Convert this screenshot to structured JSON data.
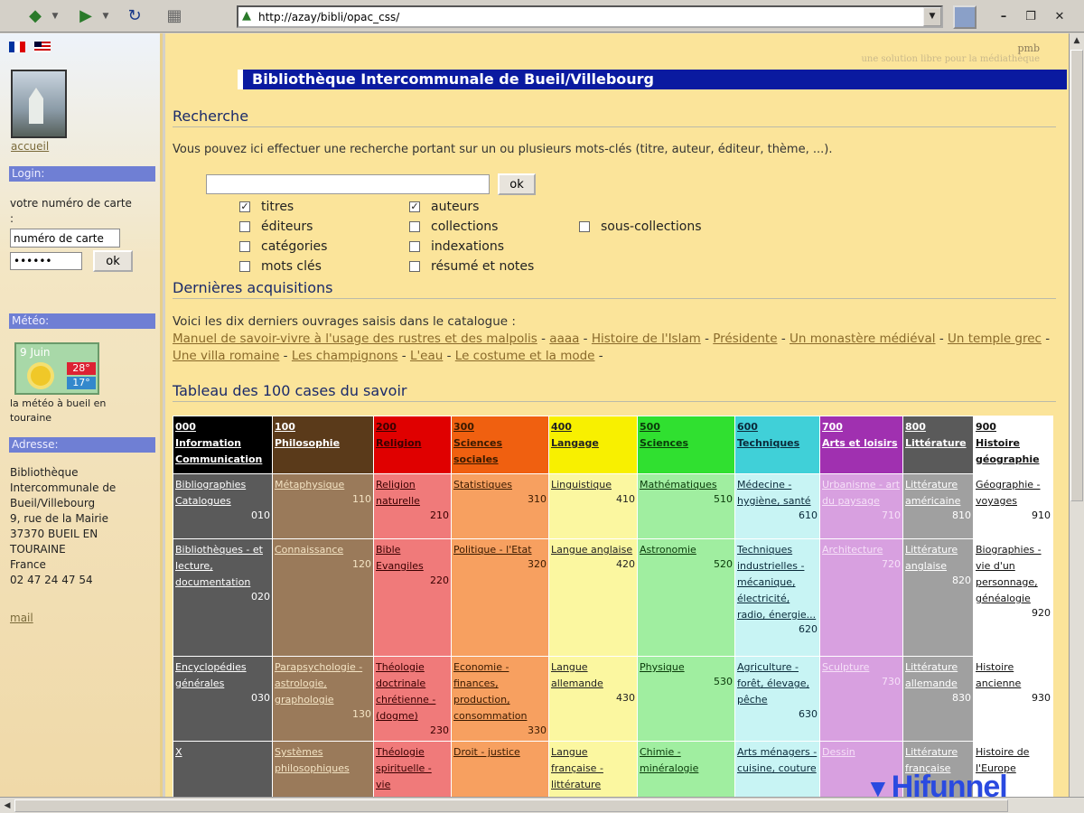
{
  "browser": {
    "url": "http://azay/bibli/opac_css/"
  },
  "sidebar": {
    "accueil": "accueil",
    "login_header": "Login:",
    "card_label": "votre numéro de carte",
    "card_colon": ":",
    "card_input": "numéro de carte",
    "password_input": "••••••",
    "ok": "ok",
    "meteo_header": "Météo:",
    "meteo_date": "9 Juin",
    "meteo_max": "28°",
    "meteo_min": "17°",
    "meteo_caption_1": "la météo à bueil en",
    "meteo_caption_2": "touraine",
    "address_header": "Adresse:",
    "address": [
      "Bibliothèque",
      "Intercommunale de",
      "Bueil/Villebourg",
      "9, rue de la Mairie",
      "37370 BUEIL EN",
      "TOURAINE",
      "France",
      "02 47 24 47 54"
    ],
    "mail": "mail"
  },
  "main": {
    "pmb": "pmb",
    "pmb_tagline": "une solution libre pour la médiathèque",
    "banner": "Bibliothèque Intercommunale de Bueil/Villebourg",
    "search_title": "Recherche",
    "search_intro": "Vous pouvez ici effectuer une recherche portant sur un ou plusieurs mots-clés (titre, auteur, éditeur, thème, ...).",
    "search_ok": "ok",
    "checks": {
      "titres": "titres",
      "auteurs": "auteurs",
      "editeurs": "éditeurs",
      "collections": "collections",
      "sous_collections": "sous-collections",
      "categories": "catégories",
      "indexations": "indexations",
      "mots_cles": "mots clés",
      "resume": "résumé et notes"
    },
    "check_mark": "✓",
    "acq_title": "Dernières acquisitions",
    "acq_intro": "Voici les dix derniers ouvrages saisis dans le catalogue :",
    "acq_sep": " - ",
    "acquisitions": [
      "Manuel de savoir-vivre à l'usage des rustres et des malpolis",
      "aaaa",
      "Histoire de l'Islam",
      "Présidente",
      "Un monastère médiéval",
      "Un temple grec",
      "Une villa romaine",
      "Les champignons",
      "L'eau",
      "Le costume et la mode"
    ],
    "grid_title": "Tableau des 100 cases du savoir"
  },
  "grid": {
    "columns": [
      {
        "code": "000",
        "name": "Information Communication",
        "bg": "#000000",
        "cell": "#5a5a5a",
        "fg": "#ffffff",
        "hfg": "#ffffff"
      },
      {
        "code": "100",
        "name": "Philosophie",
        "bg": "#5a3a1a",
        "cell": "#9a7a5a",
        "fg": "#f3e3c3",
        "hfg": "#ffffff"
      },
      {
        "code": "200",
        "name": "Religion",
        "bg": "#e00000",
        "cell": "#f07a7a",
        "fg": "#3a0000",
        "hfg": "#3a0000"
      },
      {
        "code": "300",
        "name": "Sciences sociales",
        "bg": "#f06010",
        "cell": "#f7a060",
        "fg": "#3a1a00",
        "hfg": "#3a1a00"
      },
      {
        "code": "400",
        "name": "Langage",
        "bg": "#f8f000",
        "cell": "#fbf7a0",
        "fg": "#222222",
        "hfg": "#222222"
      },
      {
        "code": "500",
        "name": "Sciences",
        "bg": "#30e030",
        "cell": "#a0eea0",
        "fg": "#0a3a0a",
        "hfg": "#0a3a0a"
      },
      {
        "code": "600",
        "name": "Techniques",
        "bg": "#40d0d8",
        "cell": "#c8f4f4",
        "fg": "#0a2a3a",
        "hfg": "#0a2a3a"
      },
      {
        "code": "700",
        "name": "Arts et loisirs",
        "bg": "#a030b0",
        "cell": "#d8a0e0",
        "fg": "#f6e0f8",
        "hfg": "#ffffff"
      },
      {
        "code": "800",
        "name": "Littérature",
        "bg": "#5a5a5a",
        "cell": "#a0a0a0",
        "fg": "#ffffff",
        "hfg": "#ffffff"
      },
      {
        "code": "900",
        "name": "Histoire géographie",
        "bg": "#ffffff",
        "cell": "#ffffff",
        "fg": "#111111",
        "hfg": "#111111"
      }
    ],
    "rows": [
      [
        [
          "Bibliographies Catalogues",
          "010"
        ],
        [
          "Métaphysique",
          "110"
        ],
        [
          "Religion naturelle",
          "210"
        ],
        [
          "Statistiques",
          "310"
        ],
        [
          "Linguistique",
          "410"
        ],
        [
          "Mathématiques",
          "510"
        ],
        [
          "Médecine - hygiène, santé",
          "610"
        ],
        [
          "Urbanisme - art du paysage",
          "710"
        ],
        [
          "Littérature américaine",
          "810"
        ],
        [
          "Géographie - voyages",
          "910"
        ]
      ],
      [
        [
          "Bibliothèques - et lecture, documentation",
          "020"
        ],
        [
          "Connaissance",
          "120"
        ],
        [
          "Bible Evangiles",
          "220"
        ],
        [
          "Politique - l'Etat",
          "320"
        ],
        [
          "Langue anglaise",
          "420"
        ],
        [
          "Astronomie",
          "520"
        ],
        [
          "Techniques industrielles - mécanique, électricité, radio, énergie...",
          "620"
        ],
        [
          "Architecture",
          "720"
        ],
        [
          "Littérature anglaise",
          "820"
        ],
        [
          "Biographies - vie d'un personnage, généalogie",
          "920"
        ]
      ],
      [
        [
          "Encyclopédies générales",
          "030"
        ],
        [
          "Parapsychologie - astrologie, graphologie",
          "130"
        ],
        [
          "Théologie doctrinale chrétienne - (dogme)",
          "230"
        ],
        [
          "Economie - finances, production, consommation",
          "330"
        ],
        [
          "Langue allemande",
          "430"
        ],
        [
          "Physique",
          "530"
        ],
        [
          "Agriculture - forêt, élevage, pêche",
          "630"
        ],
        [
          "Sculpture",
          "730"
        ],
        [
          "Littérature allemande",
          "830"
        ],
        [
          "Histoire ancienne",
          "930"
        ]
      ],
      [
        [
          "X",
          ""
        ],
        [
          "Systèmes philosophiques",
          ""
        ],
        [
          "Théologie spirituelle - vie",
          ""
        ],
        [
          "Droit - justice",
          ""
        ],
        [
          "Langue française - littérature",
          ""
        ],
        [
          "Chimie - minéralogie",
          ""
        ],
        [
          "Arts ménagers - cuisine, couture",
          ""
        ],
        [
          "Dessin",
          ""
        ],
        [
          "Littérature française",
          ""
        ],
        [
          "Histoire de l'Europe",
          ""
        ]
      ]
    ]
  },
  "watermark": "Hifunnel"
}
